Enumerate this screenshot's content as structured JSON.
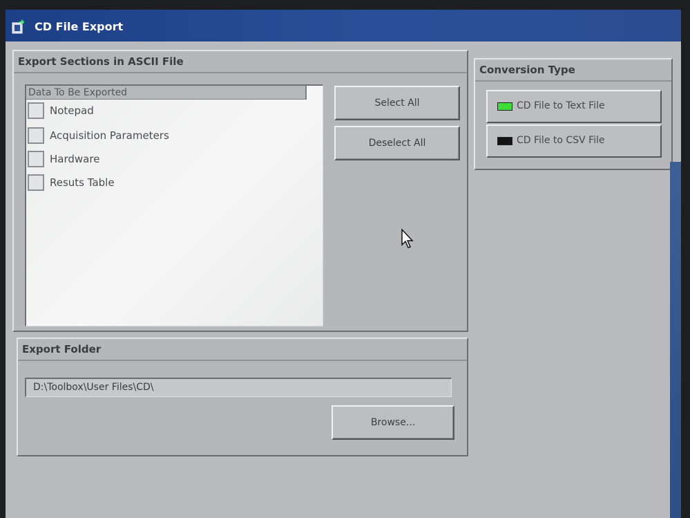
{
  "window": {
    "title": "CD File Export",
    "icon": "app-icon"
  },
  "export_sections": {
    "title": "Export Sections in ASCII File",
    "list_header": "Data To Be Exported",
    "items": [
      {
        "label": "Notepad",
        "checked": false
      },
      {
        "label": "Acquisition Parameters",
        "checked": false
      },
      {
        "label": "Hardware",
        "checked": false
      },
      {
        "label": "Resuts Table",
        "checked": false
      }
    ],
    "select_all_label": "Select All",
    "deselect_all_label": "Deselect All"
  },
  "export_folder": {
    "title": "Export Folder",
    "path": "D:\\Toolbox\\User Files\\CD\\",
    "browse_label": "Browse..."
  },
  "conversion_type": {
    "title": "Conversion Type",
    "options": [
      {
        "label": "CD File to Text File",
        "selected": true
      },
      {
        "label": "CD File to CSV File",
        "selected": false
      }
    ],
    "led_on_color": "#3fdc38",
    "led_off_color": "#141414"
  },
  "colors": {
    "titlebar": "#1d3f86",
    "panel": "#b5b7ba",
    "list_background": "#f2f2f2"
  }
}
